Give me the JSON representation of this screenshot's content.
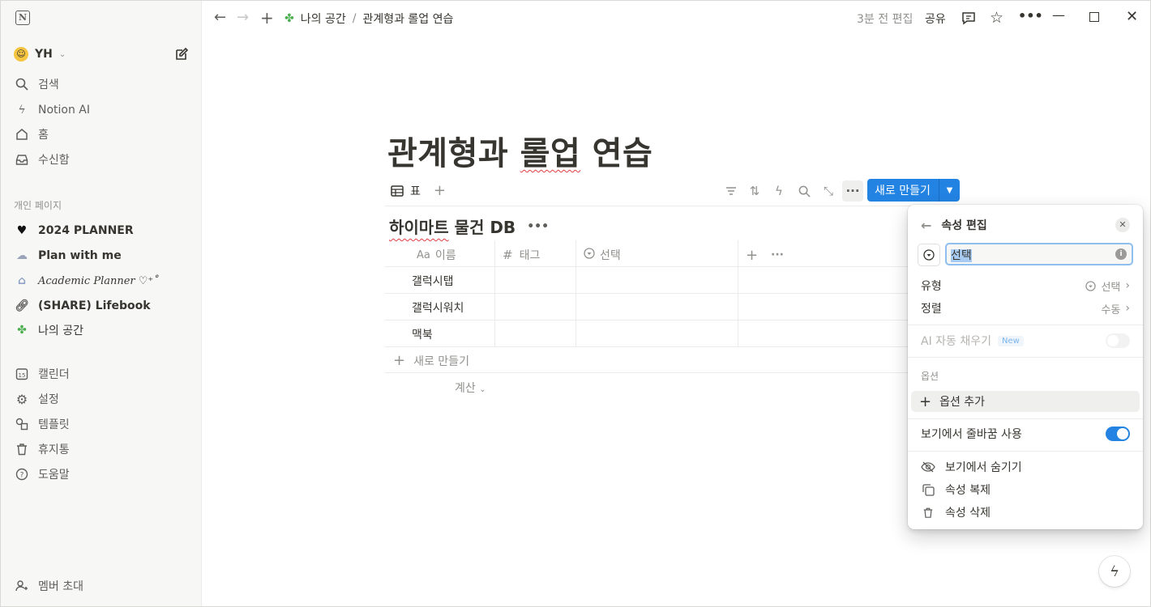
{
  "sidebar": {
    "workspace_name": "YH",
    "nav": [
      {
        "label": "검색",
        "icon": "search-icon"
      },
      {
        "label": "Notion AI",
        "icon": "notion-ai-icon"
      },
      {
        "label": "홈",
        "icon": "home-icon"
      },
      {
        "label": "수신함",
        "icon": "inbox-icon"
      }
    ],
    "section_label": "개인 페이지",
    "pages": [
      {
        "label": "2024 PLANNER",
        "icon": "heart-icon"
      },
      {
        "label": "Plan with me",
        "icon": "cloud-icon"
      },
      {
        "label": "Academic Planner ♡⁺˚",
        "icon": "building-icon"
      },
      {
        "label": "(SHARE) Lifebook",
        "icon": "link-icon"
      },
      {
        "label": "나의 공간",
        "icon": "clover-icon"
      }
    ],
    "tools": [
      {
        "label": "캘린더",
        "icon": "calendar-icon"
      },
      {
        "label": "설정",
        "icon": "gear-icon"
      },
      {
        "label": "템플릿",
        "icon": "template-icon"
      },
      {
        "label": "휴지통",
        "icon": "trash-icon"
      },
      {
        "label": "도움말",
        "icon": "help-icon"
      }
    ],
    "invite_label": "멤버 초대"
  },
  "topbar": {
    "breadcrumb": [
      "나의 공간",
      "관계형과 롤업 연습"
    ],
    "edited": "3분 전 편집",
    "share": "공유"
  },
  "page": {
    "title_part1": "관계형과 ",
    "title_part2": "롤업",
    "title_part3": " 연습"
  },
  "view": {
    "tab_label": "표",
    "new_button": "새로 만들기"
  },
  "database": {
    "title_part1": "하이마트",
    "title_part2": " 물건 DB",
    "columns": [
      {
        "label": "이름",
        "icon": "Aa"
      },
      {
        "label": "태그",
        "icon": "#"
      },
      {
        "label": "선택",
        "icon": "select-icon"
      }
    ],
    "rows": [
      "갤럭시탭",
      "갤럭시워치",
      "맥북"
    ],
    "new_row": "새로 만들기",
    "calculate": "계산"
  },
  "property_editor": {
    "title": "속성 편집",
    "name_value": "선택",
    "type_label": "유형",
    "type_value": "선택",
    "sort_label": "정렬",
    "sort_value": "수동",
    "ai_autofill_label": "AI 자동 채우기",
    "ai_badge": "New",
    "ai_autofill_enabled": false,
    "options_section": "옵션",
    "add_option": "옵션 추가",
    "wrap_label": "보기에서 줄바꿈 사용",
    "wrap_enabled": true,
    "hide_label": "보기에서 숨기기",
    "duplicate_label": "속성 복제",
    "delete_label": "속성 삭제"
  },
  "colors": {
    "accent": "#2383e2",
    "sidebar_bg": "#f7f7f5",
    "text": "#37352f",
    "muted": "#91918e"
  }
}
